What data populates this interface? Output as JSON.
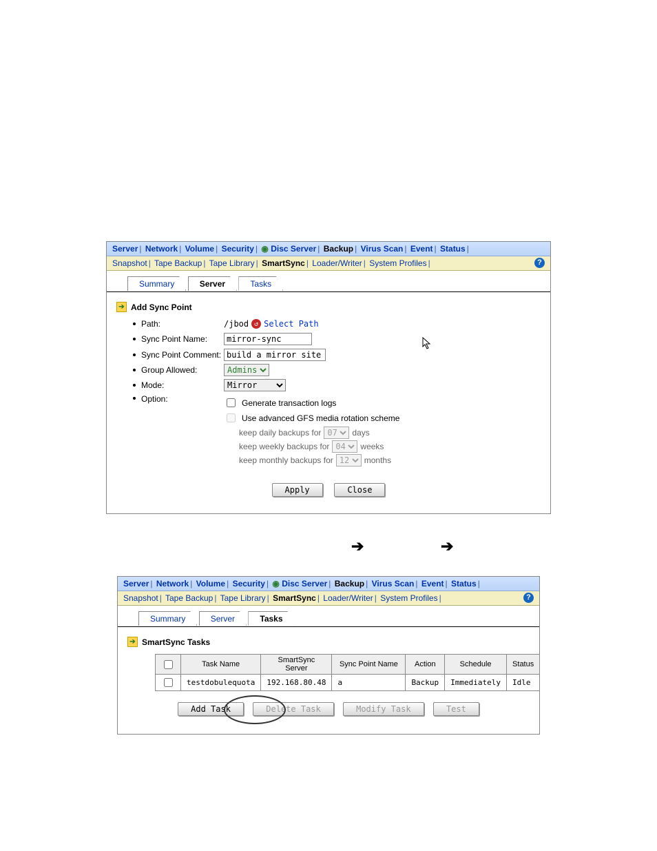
{
  "nav": {
    "main": [
      "Server",
      "Network",
      "Volume",
      "Security",
      "Disc Server",
      "Backup",
      "Virus Scan",
      "Event",
      "Status"
    ],
    "sub": [
      "Snapshot",
      "Tape Backup",
      "Tape Library",
      "SmartSync",
      "Loader/Writer",
      "System Profiles"
    ],
    "sub_active": "SmartSync"
  },
  "tabs1": {
    "items": [
      "Summary",
      "Server",
      "Tasks"
    ],
    "active": "Server"
  },
  "tabs2": {
    "items": [
      "Summary",
      "Server",
      "Tasks"
    ],
    "active": "Tasks"
  },
  "section1_title": "Add Sync Point",
  "form": {
    "path_label": "Path:",
    "path_value": "/jbod",
    "select_path": "Select Path",
    "name_label": "Sync Point Name:",
    "name_value": "mirror-sync",
    "comment_label": "Sync Point Comment:",
    "comment_value": "build a mirror site",
    "group_label": "Group Allowed:",
    "group_value": "Admins",
    "mode_label": "Mode:",
    "mode_value": "Mirror",
    "option_label": "Option:",
    "opt1": "Generate transaction logs",
    "opt2": "Use advanced GFS media rotation scheme",
    "keep_daily_pre": "keep daily backups for",
    "keep_daily_val": "07",
    "keep_daily_post": "days",
    "keep_weekly_pre": "keep weekly backups for",
    "keep_weekly_val": "04",
    "keep_weekly_post": "weeks",
    "keep_monthly_pre": "keep monthly backups for",
    "keep_monthly_val": "12",
    "keep_monthly_post": "months"
  },
  "buttons1": {
    "apply": "Apply",
    "close": "Close"
  },
  "section2_title": "SmartSync Tasks",
  "table": {
    "headers": [
      "",
      "Task Name",
      "SmartSync Server",
      "Sync Point Name",
      "Action",
      "Schedule",
      "Status"
    ],
    "row": {
      "task": "testdobulequota",
      "server": "192.168.80.48",
      "point": "a",
      "action": "Backup",
      "schedule": "Immediately",
      "status": "Idle"
    }
  },
  "buttons2": {
    "add": "Add Task",
    "del": "Delete Task",
    "mod": "Modify Task",
    "test": "Test"
  }
}
